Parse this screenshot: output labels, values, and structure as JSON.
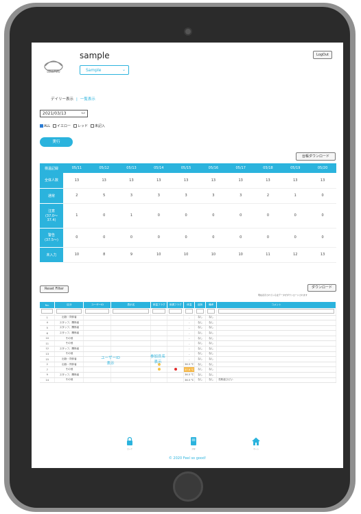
{
  "header": {
    "title": "sample",
    "logo_text": "bubbFlow",
    "selected_site": "Sample",
    "logout_label": "LogOut"
  },
  "view": {
    "daily_label": "デイリー表示",
    "list_label": "一覧表示"
  },
  "date_value": "2021/03/13",
  "filters": [
    {
      "label": "ALL",
      "checked": true
    },
    {
      "label": "イエロー",
      "checked": false
    },
    {
      "label": "レッド",
      "checked": false
    },
    {
      "label": "未記入",
      "checked": false
    }
  ],
  "run_label": "実行",
  "ledger_download_label": "台帳ダウンロード",
  "summary": {
    "corner": "検温記録",
    "dates": [
      "05/11",
      "05/12",
      "05/13",
      "05/14",
      "05/15",
      "05/16",
      "05/17",
      "05/18",
      "05/19",
      "05/20"
    ],
    "rows": [
      {
        "label": "全体人数",
        "values": [
          "13",
          "13",
          "13",
          "13",
          "13",
          "13",
          "13",
          "13",
          "13",
          "13"
        ]
      },
      {
        "label": "通常",
        "values": [
          "2",
          "5",
          "3",
          "3",
          "3",
          "3",
          "3",
          "2",
          "1",
          "0"
        ]
      },
      {
        "label": "注意\n(37.0〜37.4)",
        "values": [
          "1",
          "0",
          "1",
          "0",
          "0",
          "0",
          "0",
          "0",
          "0",
          "0"
        ]
      },
      {
        "label": "警告\n(37.5〜)",
        "values": [
          "0",
          "0",
          "0",
          "0",
          "0",
          "0",
          "0",
          "0",
          "0",
          "0"
        ]
      },
      {
        "label": "未入力",
        "values": [
          "10",
          "8",
          "9",
          "10",
          "10",
          "10",
          "10",
          "11",
          "12",
          "13"
        ]
      }
    ]
  },
  "reset_filter_label": "Reset Filter",
  "download_label": "ダウンロード",
  "download_note": "現在表示されている全データがダウンロードされます",
  "detail": {
    "headers": [
      "No.",
      "区分",
      "ユーザーID",
      "表示名",
      "体温フラグ",
      "体調フラグ",
      "体温",
      "症状",
      "備考",
      "コメント"
    ],
    "rows": [
      {
        "no": "1",
        "cat": "出勤・同伴者",
        "temp": "-",
        "s1": "なし",
        "s2": "なし",
        "comment": "",
        "flag_y": false,
        "flag_r": false,
        "hl": false
      },
      {
        "no": "4",
        "cat": "スタッフ、関係者",
        "temp": "-",
        "s1": "なし",
        "s2": "なし",
        "comment": "",
        "flag_y": false,
        "flag_r": false,
        "hl": false
      },
      {
        "no": "5",
        "cat": "スタッフ、関係者",
        "temp": "-",
        "s1": "なし",
        "s2": "なし",
        "comment": "",
        "flag_y": false,
        "flag_r": false,
        "hl": false
      },
      {
        "no": "6",
        "cat": "スタッフ、関係者",
        "temp": "-",
        "s1": "なし",
        "s2": "なし",
        "comment": "",
        "flag_y": false,
        "flag_r": false,
        "hl": false
      },
      {
        "no": "10",
        "cat": "その他",
        "temp": "-",
        "s1": "なし",
        "s2": "なし",
        "comment": "",
        "flag_y": false,
        "flag_r": false,
        "hl": false
      },
      {
        "no": "11",
        "cat": "その他",
        "temp": "-",
        "s1": "なし",
        "s2": "なし",
        "comment": "",
        "flag_y": false,
        "flag_r": false,
        "hl": false
      },
      {
        "no": "12",
        "cat": "スタッフ、関係者",
        "temp": "-",
        "s1": "なし",
        "s2": "なし",
        "comment": "",
        "flag_y": false,
        "flag_r": false,
        "hl": false
      },
      {
        "no": "13",
        "cat": "その他",
        "temp": "-",
        "s1": "なし",
        "s2": "なし",
        "comment": "",
        "flag_y": false,
        "flag_r": false,
        "hl": false
      },
      {
        "no": "15",
        "cat": "出勤・同伴者",
        "temp": "-",
        "s1": "なし",
        "s2": "なし",
        "comment": "",
        "flag_y": false,
        "flag_r": false,
        "hl": false
      },
      {
        "no": "2",
        "cat": "出勤・同伴者",
        "temp": "36.5 ℃",
        "s1": "なし",
        "s2": "なし",
        "comment": "",
        "flag_y": true,
        "flag_r": false,
        "hl": false
      },
      {
        "no": "7",
        "cat": "その他",
        "temp": "37.6 ℃",
        "s1": "なし",
        "s2": "なし",
        "comment": "",
        "flag_y": true,
        "flag_r": true,
        "hl": true
      },
      {
        "no": "9",
        "cat": "スタッフ、関係者",
        "temp": "36.5 ℃",
        "s1": "なし",
        "s2": "なし",
        "comment": "",
        "flag_y": false,
        "flag_r": false,
        "hl": false
      },
      {
        "no": "14",
        "cat": "その他",
        "temp": "36.5 ℃",
        "s1": "なし",
        "s2": "なし",
        "comment": "花粉症ひどい",
        "flag_y": false,
        "flag_r": false,
        "hl": false
      }
    ]
  },
  "overlay": {
    "user_id_note": "ユーザーID\n表示",
    "name_note": "参加氏名\n表示"
  },
  "footer": {
    "items": [
      {
        "icon": "lock-icon",
        "caption": "ロック"
      },
      {
        "icon": "document-icon",
        "caption": "記録"
      },
      {
        "icon": "home-icon",
        "caption": "ホーム"
      }
    ],
    "copyright": "© 2020 Feel so good!"
  },
  "colors": {
    "accent": "#2bb3dd",
    "warning": "#f6b94a",
    "alert": "#e12b2b"
  }
}
